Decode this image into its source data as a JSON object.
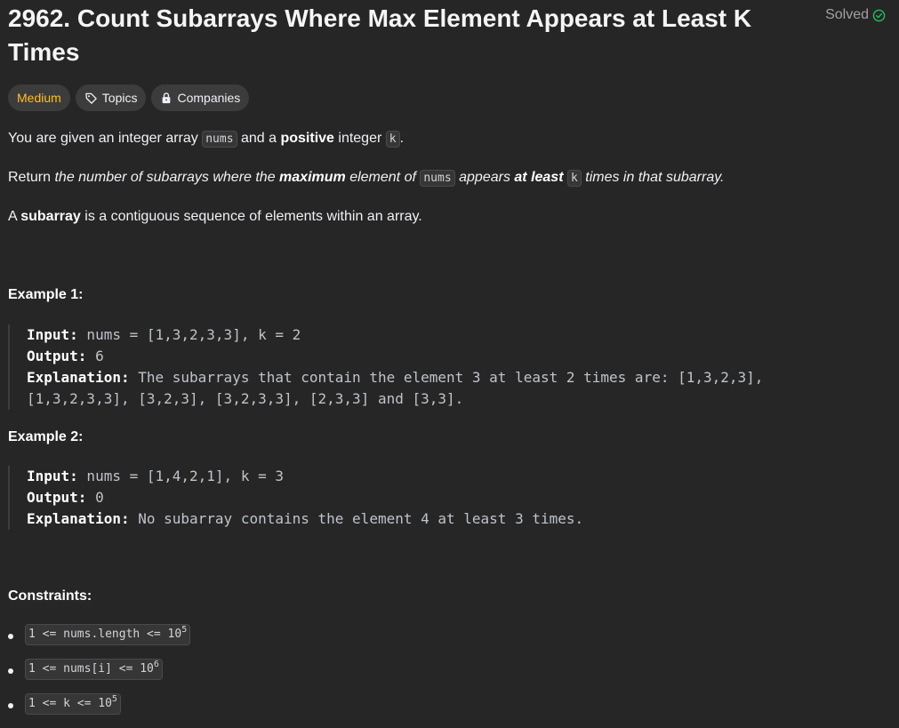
{
  "problem": {
    "title": "2962. Count Subarrays Where Max Element Appears at Least K Times",
    "status": "Solved",
    "status_color": "#2cbb5d",
    "difficulty": "Medium",
    "difficulty_color": "#ffc01e",
    "topics_label": "Topics",
    "companies_label": "Companies"
  },
  "description": {
    "p1": {
      "t1": "You are given an integer array ",
      "code1": "nums",
      "t2": " and a ",
      "bold1": "positive",
      "t3": " integer ",
      "code2": "k",
      "t4": "."
    },
    "p2": {
      "t1": "Return ",
      "it1": "the number of subarrays where the ",
      "bold1": "maximum",
      "it2": " element of ",
      "code1": "nums",
      "it3": " appears ",
      "bold2": "at least",
      "code2": "k",
      "it4": " times in that subarray."
    },
    "p3": {
      "t1": "A ",
      "bold1": "subarray",
      "t2": " is a contiguous sequence of elements within an array."
    }
  },
  "examples": [
    {
      "title": "Example 1:",
      "input_label": "Input:",
      "input_value": " nums = [1,3,2,3,3], k = 2",
      "output_label": "Output:",
      "output_value": " 6",
      "explanation_label": "Explanation:",
      "explanation_line1": " The subarrays that contain the element 3 at least 2 times are: [1,3,2,3],",
      "explanation_line2": "[1,3,2,3,3], [3,2,3], [3,2,3,3], [2,3,3] and [3,3]."
    },
    {
      "title": "Example 2:",
      "input_label": "Input:",
      "input_value": " nums = [1,4,2,1], k = 3",
      "output_label": "Output:",
      "output_value": " 0",
      "explanation_label": "Explanation:",
      "explanation_line1": " No subarray contains the element 4 at least 3 times."
    }
  ],
  "constraints": {
    "title": "Constraints:",
    "items": [
      {
        "text": "1 <= nums.length <= 10",
        "sup": "5"
      },
      {
        "text": "1 <= nums[i] <= 10",
        "sup": "6"
      },
      {
        "text": "1 <= k <= 10",
        "sup": "5"
      }
    ]
  }
}
